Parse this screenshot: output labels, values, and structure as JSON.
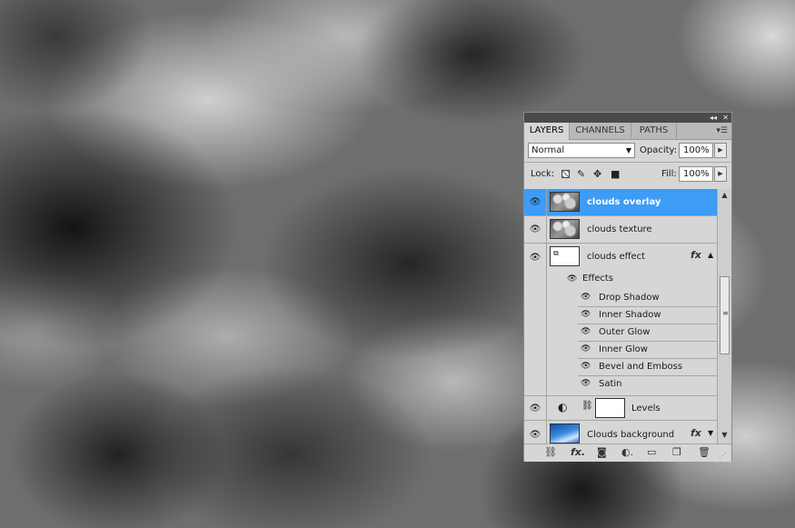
{
  "panel": {
    "tabs": [
      {
        "label": "LAYERS",
        "active": true
      },
      {
        "label": "CHANNELS",
        "active": false
      },
      {
        "label": "PATHS",
        "active": false
      }
    ],
    "blend_mode": "Normal",
    "opacity_label": "Opacity:",
    "opacity_value": "100%",
    "lock_label": "Lock:",
    "fill_label": "Fill:",
    "fill_value": "100%"
  },
  "layers": [
    {
      "name": "clouds overlay",
      "selected": true,
      "thumb": "clouds"
    },
    {
      "name": "clouds texture",
      "selected": false,
      "thumb": "clouds"
    },
    {
      "name": "clouds effect",
      "selected": false,
      "thumb": "smart-object",
      "has_fx": true
    },
    {
      "name": "Levels",
      "selected": false,
      "thumb": "adjustment-mask"
    },
    {
      "name": "Clouds background",
      "selected": false,
      "thumb": "blue-sky",
      "has_fx": true
    }
  ],
  "effects_header": "Effects",
  "effects": [
    "Drop Shadow",
    "Inner Shadow",
    "Outer Glow",
    "Inner Glow",
    "Bevel and Emboss",
    "Satin"
  ],
  "fx_symbol": "fx",
  "colors": {
    "selection": "#3c9cf6",
    "panel_bg": "#d6d6d6",
    "titlebar": "#4a4a4a"
  },
  "icons": [
    "eye-icon",
    "lock-transparency-icon",
    "brush-icon",
    "move-icon",
    "lock-icon",
    "link-icon",
    "fx-icon",
    "mask-icon",
    "adjustment-icon",
    "group-folder-icon",
    "new-layer-icon",
    "trash-icon"
  ]
}
